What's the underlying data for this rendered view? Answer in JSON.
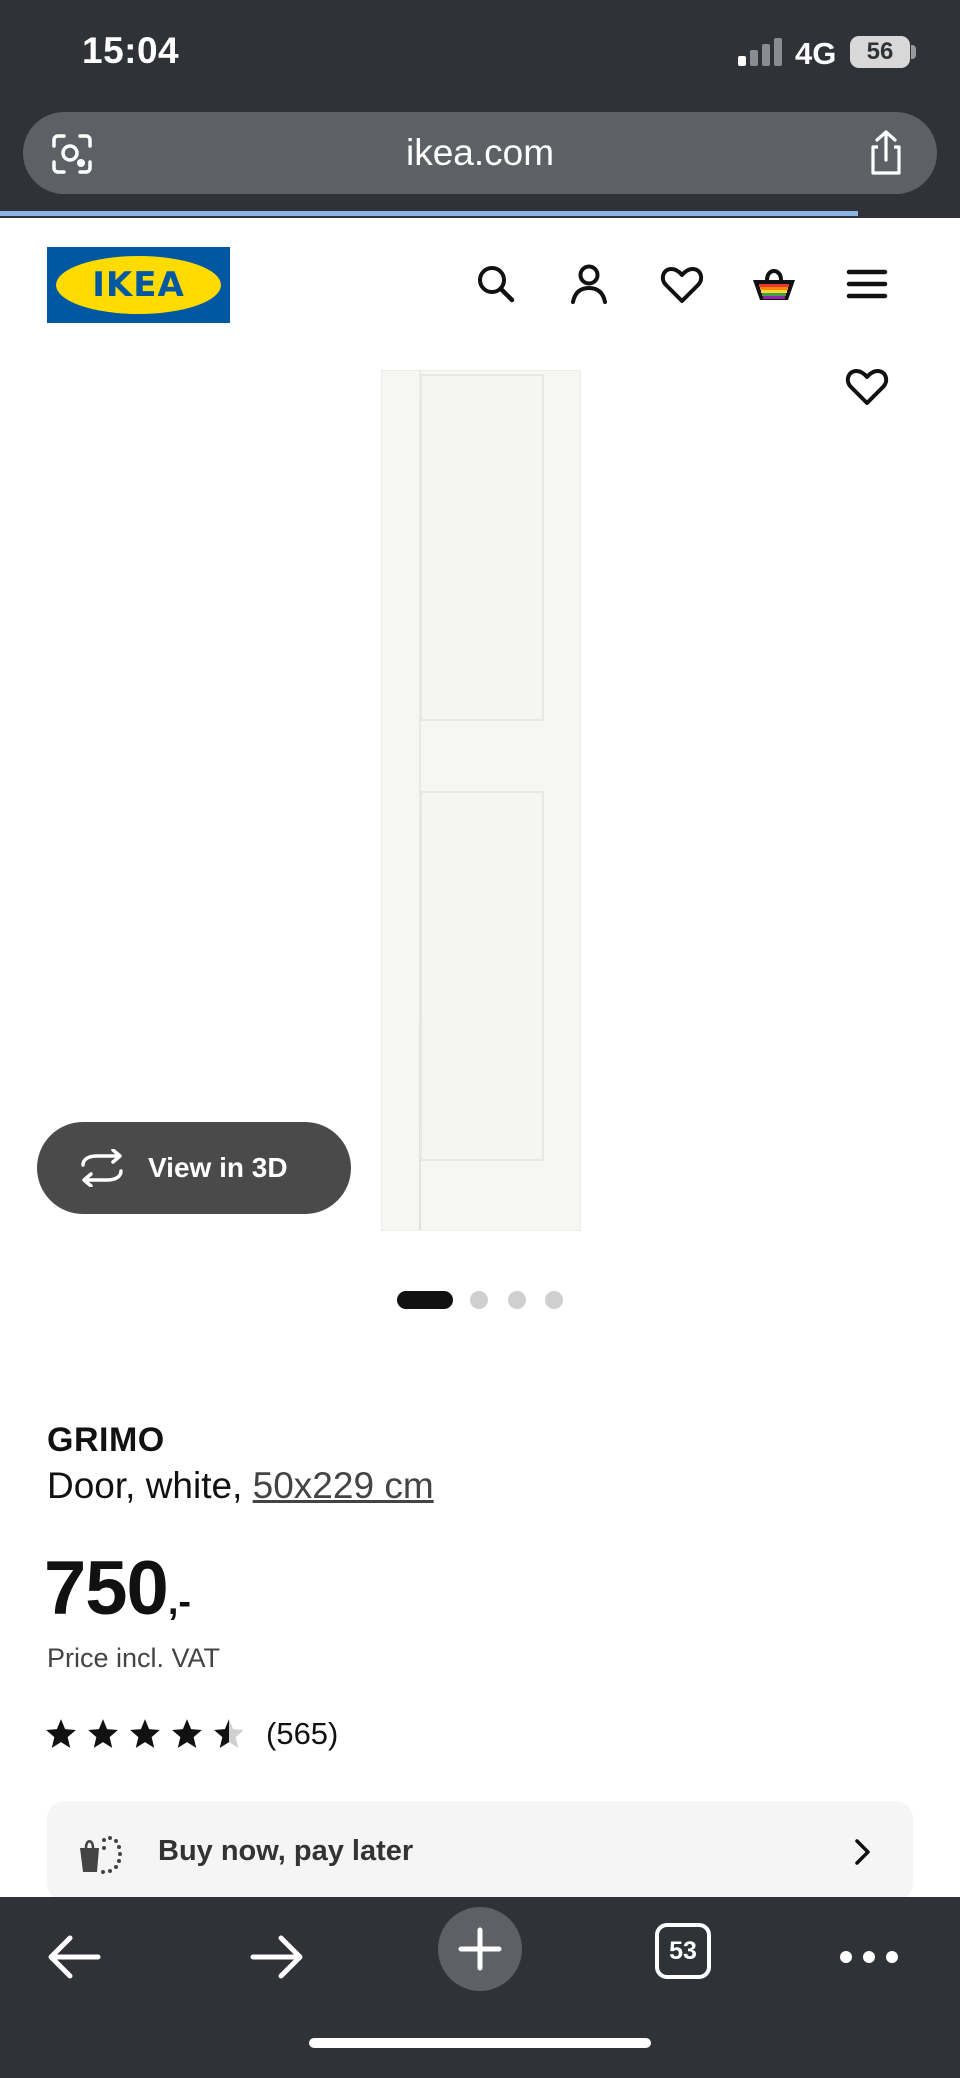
{
  "status_bar": {
    "time": "15:04",
    "network": "4G",
    "battery": "56"
  },
  "browser": {
    "url": "ikea.com",
    "tabs_count": "53"
  },
  "site": {
    "logo_text": "IKEA",
    "brand_colors": {
      "blue": "#0058a3",
      "yellow": "#ffdb00"
    }
  },
  "header_icons": [
    "search-icon",
    "account-icon",
    "heart-icon",
    "basket-icon",
    "menu-icon"
  ],
  "gallery": {
    "view_3d_label": "View in 3D",
    "slide_count": 4,
    "active_slide": 1
  },
  "product": {
    "name": "GRIMO",
    "description_prefix": "Door, white, ",
    "size": "50x229 cm",
    "price_integer": "750",
    "price_suffix": ",-",
    "vat_note": "Price incl. VAT",
    "rating": 4.5,
    "reviews_count": "(565)"
  },
  "payment": {
    "bnpl_label": "Buy now, pay later"
  }
}
